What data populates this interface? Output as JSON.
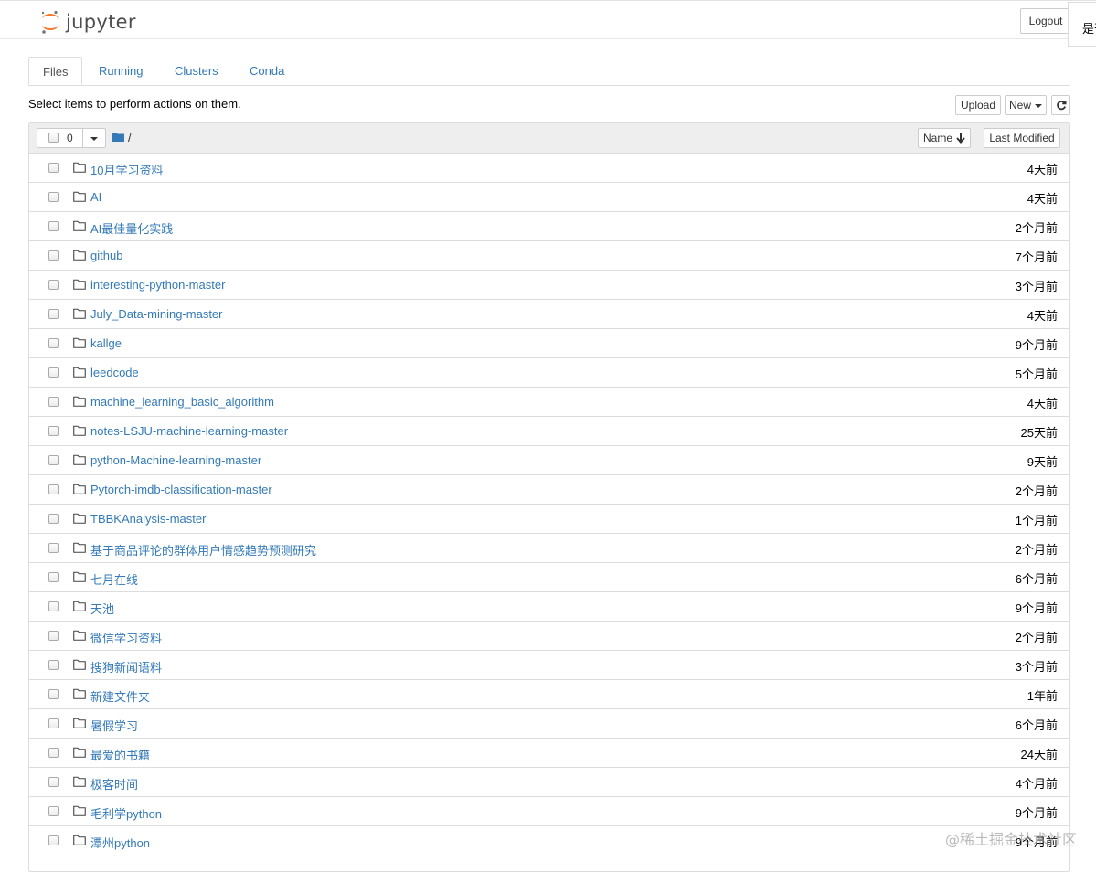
{
  "header": {
    "app_name": "jupyter",
    "logout_label": "Logout",
    "popup_text": "是否"
  },
  "tabs": [
    {
      "label": "Files",
      "active": true
    },
    {
      "label": "Running",
      "active": false
    },
    {
      "label": "Clusters",
      "active": false
    },
    {
      "label": "Conda",
      "active": false
    }
  ],
  "toolbar": {
    "hint": "Select items to perform actions on them.",
    "upload_label": "Upload",
    "new_label": "New",
    "refresh_icon": "refresh-icon"
  },
  "list_header": {
    "selected_count": "0",
    "root_path": "/",
    "sort_name_label": "Name",
    "last_modified_label": "Last Modified"
  },
  "items": [
    {
      "name": "10月学习资料",
      "modified": "4天前"
    },
    {
      "name": "AI",
      "modified": "4天前"
    },
    {
      "name": "AI最佳量化实践",
      "modified": "2个月前"
    },
    {
      "name": "github",
      "modified": "7个月前"
    },
    {
      "name": "interesting-python-master",
      "modified": "3个月前"
    },
    {
      "name": "July_Data-mining-master",
      "modified": "4天前"
    },
    {
      "name": "kallge",
      "modified": "9个月前"
    },
    {
      "name": "leedcode",
      "modified": "5个月前"
    },
    {
      "name": "machine_learning_basic_algorithm",
      "modified": "4天前"
    },
    {
      "name": "notes-LSJU-machine-learning-master",
      "modified": "25天前"
    },
    {
      "name": "python-Machine-learning-master",
      "modified": "9天前"
    },
    {
      "name": "Pytorch-imdb-classification-master",
      "modified": "2个月前"
    },
    {
      "name": "TBBKAnalysis-master",
      "modified": "1个月前"
    },
    {
      "name": " 基于商品评论的群体用户情感趋势预测研究",
      "modified": "2个月前"
    },
    {
      "name": "七月在线",
      "modified": "6个月前"
    },
    {
      "name": "天池",
      "modified": "9个月前"
    },
    {
      "name": "微信学习资料",
      "modified": "2个月前"
    },
    {
      "name": "搜狗新闻语料",
      "modified": "3个月前"
    },
    {
      "name": "新建文件夹",
      "modified": "1年前"
    },
    {
      "name": "暑假学习",
      "modified": "6个月前"
    },
    {
      "name": "最爱的书籍",
      "modified": "24天前"
    },
    {
      "name": "极客时间",
      "modified": "4个月前"
    },
    {
      "name": "毛利学python",
      "modified": "9个月前"
    },
    {
      "name": "潭州python",
      "modified": "9个月前"
    }
  ],
  "watermark": "@稀土掘金技术社区",
  "colors": {
    "link": "#337ab7",
    "logo_orange": "#f37726",
    "header_bg": "#eeeeee",
    "border": "#dddddd"
  }
}
